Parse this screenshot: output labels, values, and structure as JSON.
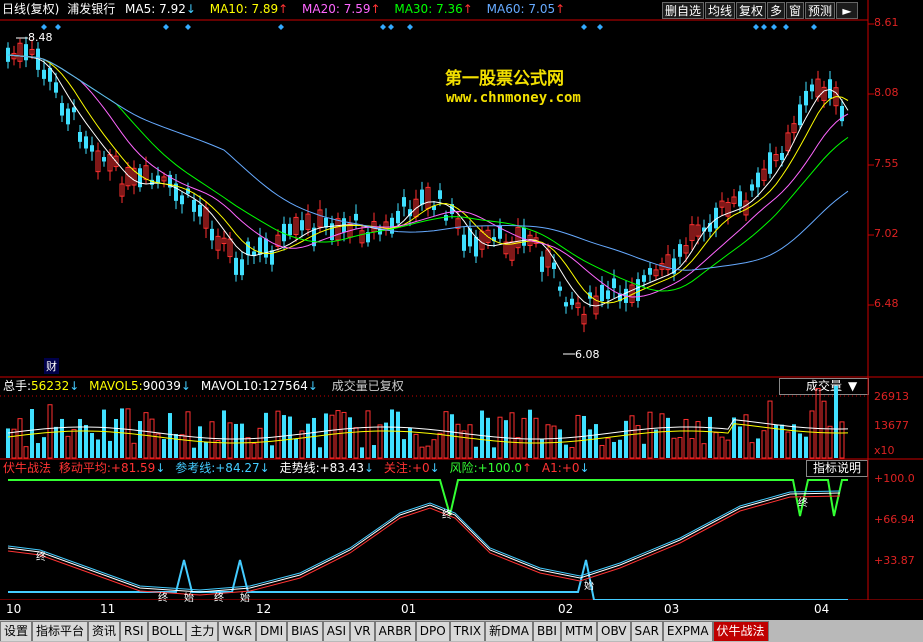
{
  "header": {
    "title_prefix": "日线(复权)",
    "stock_name": "浦发银行",
    "ma5": {
      "label": "MA5:",
      "value": "7.92",
      "arrow": "↓",
      "color": "#ffffff"
    },
    "ma10": {
      "label": "MA10:",
      "value": "7.89",
      "arrow": "↑",
      "color": "#ffff00"
    },
    "ma20": {
      "label": "MA20:",
      "value": "7.59",
      "arrow": "↑",
      "color": "#ff66ff"
    },
    "ma30": {
      "label": "MA30:",
      "value": "7.36",
      "arrow": "↑",
      "color": "#00ff00"
    },
    "ma60": {
      "label": "MA60:",
      "value": "7.05",
      "arrow": "↑",
      "color": "#66aaff"
    }
  },
  "toolbar": {
    "del_pick": "删自选",
    "avg_line": "均线",
    "restore": "复权",
    "multi": "多",
    "window": "窗",
    "forecast": "预测"
  },
  "price_axis": [
    "8.61",
    "8.08",
    "7.55",
    "7.02",
    "6.48"
  ],
  "annotations": {
    "high": "8.48",
    "low": "6.08",
    "fin_marker": "财"
  },
  "watermark": {
    "line1": "第一股票公式网",
    "line2": "www.chnmoney.com"
  },
  "volume": {
    "total_label": "总手:",
    "total_value": "56232",
    "total_arrow": "↓",
    "mavol5_label": "MAVOL5:",
    "mavol5_value": "90039",
    "mavol5_arrow": "↓",
    "mavol10_label": "MAVOL10:",
    "mavol10_value": "127564",
    "mavol10_arrow": "↓",
    "note": "成交量已复权",
    "selector": "成交量",
    "axis": [
      "26913",
      "13677"
    ],
    "unit": "x10"
  },
  "indicator": {
    "name": "伏牛战法",
    "move_label": "移动平均:",
    "move_value": "+81.59",
    "move_arrow": "↓",
    "ref_label": "参考线:",
    "ref_value": "+84.27",
    "ref_arrow": "↓",
    "trend_label": "走势线:",
    "trend_value": "+83.43",
    "trend_arrow": "↓",
    "watch_label": "关注:",
    "watch_value": "+0",
    "watch_arrow": "↓",
    "risk_label": "风险:",
    "risk_value": "+100.0",
    "risk_arrow": "↑",
    "a1_label": "A1:",
    "a1_value": "+0",
    "a1_arrow": "↓",
    "help": "指标说明",
    "axis": [
      "+100.0",
      "+66.94",
      "+33.87"
    ],
    "markers": [
      "终",
      "终",
      "始",
      "终",
      "始",
      "终",
      "始",
      "终"
    ]
  },
  "dates": [
    "10",
    "11",
    "12",
    "01",
    "02",
    "03",
    "04"
  ],
  "tabs": [
    "设置",
    "指标平台",
    "资讯",
    "RSI",
    "BOLL",
    "主力",
    "W&R",
    "DMI",
    "BIAS",
    "ASI",
    "VR",
    "ARBR",
    "DPO",
    "TRIX",
    "新DMA",
    "BBI",
    "MTM",
    "OBV",
    "SAR",
    "EXPMA",
    "伏牛战法"
  ],
  "colors": {
    "up": "#ff3030",
    "down": "#40e0ff",
    "axis_red": "#cc0000",
    "risk_green": "#33ff33",
    "ma60": "#66aaff"
  }
}
